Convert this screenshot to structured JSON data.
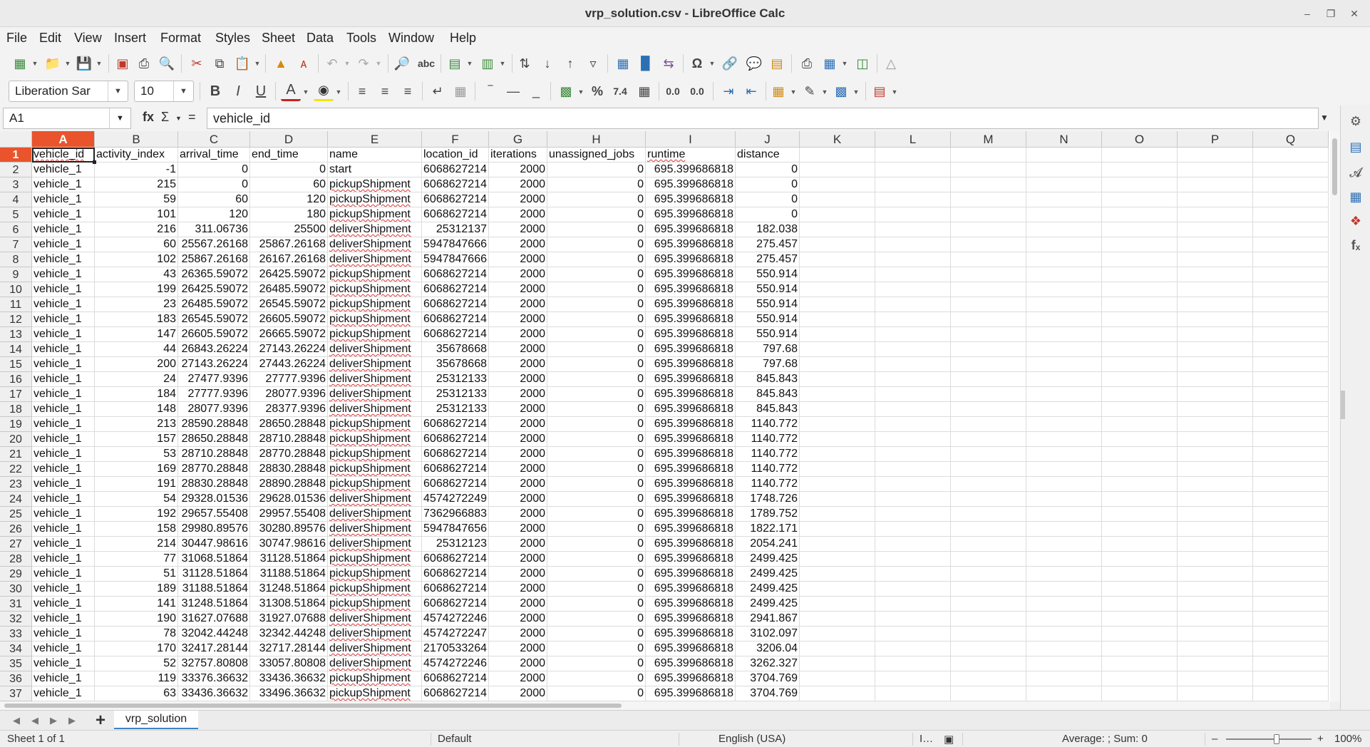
{
  "window": {
    "title": "vrp_solution.csv - LibreOffice Calc"
  },
  "menu": [
    "File",
    "Edit",
    "View",
    "Insert",
    "Format",
    "Styles",
    "Sheet",
    "Data",
    "Tools",
    "Window",
    "Help"
  ],
  "toolbar": {
    "font_name": "Liberation Sar",
    "font_size": "10",
    "percent_label": "%",
    "number_label": "7.4",
    "add_decimal_label": "0.0",
    "del_decimal_label": "0.0"
  },
  "formula_bar": {
    "cell_ref": "A1",
    "content": "vehicle_id",
    "fx_label": "fx",
    "sum_label": "Σ",
    "equals_label": "="
  },
  "sheet": {
    "columns": [
      "A",
      "B",
      "C",
      "D",
      "E",
      "F",
      "G",
      "H",
      "I",
      "J",
      "K",
      "L",
      "M",
      "N",
      "O",
      "P",
      "Q"
    ],
    "row_numbers": [
      "1",
      "2",
      "3",
      "4",
      "5",
      "6",
      "7",
      "8",
      "9",
      "10",
      "11",
      "12",
      "13",
      "14",
      "15",
      "16",
      "17",
      "18",
      "19",
      "20",
      "21",
      "22",
      "23",
      "24",
      "25",
      "26",
      "27",
      "28",
      "29",
      "30",
      "31",
      "32",
      "33",
      "34",
      "35",
      "36",
      "37"
    ],
    "headers": [
      "vehicle_id",
      "activity_index",
      "arrival_time",
      "end_time",
      "name",
      "location_id",
      "iterations",
      "unassigned_jobs",
      "runtime",
      "distance"
    ],
    "rows": [
      [
        "vehicle_1",
        "-1",
        "0",
        "0",
        "start",
        "6068627214",
        "2000",
        "0",
        "695.399686818",
        "0"
      ],
      [
        "vehicle_1",
        "215",
        "0",
        "60",
        "pickupShipment",
        "6068627214",
        "2000",
        "0",
        "695.399686818",
        "0"
      ],
      [
        "vehicle_1",
        "59",
        "60",
        "120",
        "pickupShipment",
        "6068627214",
        "2000",
        "0",
        "695.399686818",
        "0"
      ],
      [
        "vehicle_1",
        "101",
        "120",
        "180",
        "pickupShipment",
        "6068627214",
        "2000",
        "0",
        "695.399686818",
        "0"
      ],
      [
        "vehicle_1",
        "216",
        "311.06736",
        "25500",
        "deliverShipment",
        "25312137",
        "2000",
        "0",
        "695.399686818",
        "182.038"
      ],
      [
        "vehicle_1",
        "60",
        "25567.26168",
        "25867.26168",
        "deliverShipment",
        "5947847666",
        "2000",
        "0",
        "695.399686818",
        "275.457"
      ],
      [
        "vehicle_1",
        "102",
        "25867.26168",
        "26167.26168",
        "deliverShipment",
        "5947847666",
        "2000",
        "0",
        "695.399686818",
        "275.457"
      ],
      [
        "vehicle_1",
        "43",
        "26365.59072",
        "26425.59072",
        "pickupShipment",
        "6068627214",
        "2000",
        "0",
        "695.399686818",
        "550.914"
      ],
      [
        "vehicle_1",
        "199",
        "26425.59072",
        "26485.59072",
        "pickupShipment",
        "6068627214",
        "2000",
        "0",
        "695.399686818",
        "550.914"
      ],
      [
        "vehicle_1",
        "23",
        "26485.59072",
        "26545.59072",
        "pickupShipment",
        "6068627214",
        "2000",
        "0",
        "695.399686818",
        "550.914"
      ],
      [
        "vehicle_1",
        "183",
        "26545.59072",
        "26605.59072",
        "pickupShipment",
        "6068627214",
        "2000",
        "0",
        "695.399686818",
        "550.914"
      ],
      [
        "vehicle_1",
        "147",
        "26605.59072",
        "26665.59072",
        "pickupShipment",
        "6068627214",
        "2000",
        "0",
        "695.399686818",
        "550.914"
      ],
      [
        "vehicle_1",
        "44",
        "26843.26224",
        "27143.26224",
        "deliverShipment",
        "35678668",
        "2000",
        "0",
        "695.399686818",
        "797.68"
      ],
      [
        "vehicle_1",
        "200",
        "27143.26224",
        "27443.26224",
        "deliverShipment",
        "35678668",
        "2000",
        "0",
        "695.399686818",
        "797.68"
      ],
      [
        "vehicle_1",
        "24",
        "27477.9396",
        "27777.9396",
        "deliverShipment",
        "25312133",
        "2000",
        "0",
        "695.399686818",
        "845.843"
      ],
      [
        "vehicle_1",
        "184",
        "27777.9396",
        "28077.9396",
        "deliverShipment",
        "25312133",
        "2000",
        "0",
        "695.399686818",
        "845.843"
      ],
      [
        "vehicle_1",
        "148",
        "28077.9396",
        "28377.9396",
        "deliverShipment",
        "25312133",
        "2000",
        "0",
        "695.399686818",
        "845.843"
      ],
      [
        "vehicle_1",
        "213",
        "28590.28848",
        "28650.28848",
        "pickupShipment",
        "6068627214",
        "2000",
        "0",
        "695.399686818",
        "1140.772"
      ],
      [
        "vehicle_1",
        "157",
        "28650.28848",
        "28710.28848",
        "pickupShipment",
        "6068627214",
        "2000",
        "0",
        "695.399686818",
        "1140.772"
      ],
      [
        "vehicle_1",
        "53",
        "28710.28848",
        "28770.28848",
        "pickupShipment",
        "6068627214",
        "2000",
        "0",
        "695.399686818",
        "1140.772"
      ],
      [
        "vehicle_1",
        "169",
        "28770.28848",
        "28830.28848",
        "pickupShipment",
        "6068627214",
        "2000",
        "0",
        "695.399686818",
        "1140.772"
      ],
      [
        "vehicle_1",
        "191",
        "28830.28848",
        "28890.28848",
        "pickupShipment",
        "6068627214",
        "2000",
        "0",
        "695.399686818",
        "1140.772"
      ],
      [
        "vehicle_1",
        "54",
        "29328.01536",
        "29628.01536",
        "deliverShipment",
        "4574272249",
        "2000",
        "0",
        "695.399686818",
        "1748.726"
      ],
      [
        "vehicle_1",
        "192",
        "29657.55408",
        "29957.55408",
        "deliverShipment",
        "7362966883",
        "2000",
        "0",
        "695.399686818",
        "1789.752"
      ],
      [
        "vehicle_1",
        "158",
        "29980.89576",
        "30280.89576",
        "deliverShipment",
        "5947847656",
        "2000",
        "0",
        "695.399686818",
        "1822.171"
      ],
      [
        "vehicle_1",
        "214",
        "30447.98616",
        "30747.98616",
        "deliverShipment",
        "25312123",
        "2000",
        "0",
        "695.399686818",
        "2054.241"
      ],
      [
        "vehicle_1",
        "77",
        "31068.51864",
        "31128.51864",
        "pickupShipment",
        "6068627214",
        "2000",
        "0",
        "695.399686818",
        "2499.425"
      ],
      [
        "vehicle_1",
        "51",
        "31128.51864",
        "31188.51864",
        "pickupShipment",
        "6068627214",
        "2000",
        "0",
        "695.399686818",
        "2499.425"
      ],
      [
        "vehicle_1",
        "189",
        "31188.51864",
        "31248.51864",
        "pickupShipment",
        "6068627214",
        "2000",
        "0",
        "695.399686818",
        "2499.425"
      ],
      [
        "vehicle_1",
        "141",
        "31248.51864",
        "31308.51864",
        "pickupShipment",
        "6068627214",
        "2000",
        "0",
        "695.399686818",
        "2499.425"
      ],
      [
        "vehicle_1",
        "190",
        "31627.07688",
        "31927.07688",
        "deliverShipment",
        "4574272246",
        "2000",
        "0",
        "695.399686818",
        "2941.867"
      ],
      [
        "vehicle_1",
        "78",
        "32042.44248",
        "32342.44248",
        "deliverShipment",
        "4574272247",
        "2000",
        "0",
        "695.399686818",
        "3102.097"
      ],
      [
        "vehicle_1",
        "170",
        "32417.28144",
        "32717.28144",
        "deliverShipment",
        "2170533264",
        "2000",
        "0",
        "695.399686818",
        "3206.04"
      ],
      [
        "vehicle_1",
        "52",
        "32757.80808",
        "33057.80808",
        "deliverShipment",
        "4574272246",
        "2000",
        "0",
        "695.399686818",
        "3262.327"
      ],
      [
        "vehicle_1",
        "119",
        "33376.36632",
        "33436.36632",
        "pickupShipment",
        "6068627214",
        "2000",
        "0",
        "695.399686818",
        "3704.769"
      ],
      [
        "vehicle_1",
        "63",
        "33436.36632",
        "33496.36632",
        "pickupShipment",
        "6068627214",
        "2000",
        "0",
        "695.399686818",
        "3704.769"
      ]
    ]
  },
  "tabs": {
    "sheet_name": "vrp_solution"
  },
  "status": {
    "sheet_info": "Sheet 1 of 1",
    "page_style": "Default",
    "language": "English (USA)",
    "summary": "Average: ; Sum: 0",
    "zoom": "100%"
  },
  "colors": {
    "accent": "#e9542c",
    "tab_underline": "#3b82c4",
    "spell_underline": "#d33333"
  }
}
